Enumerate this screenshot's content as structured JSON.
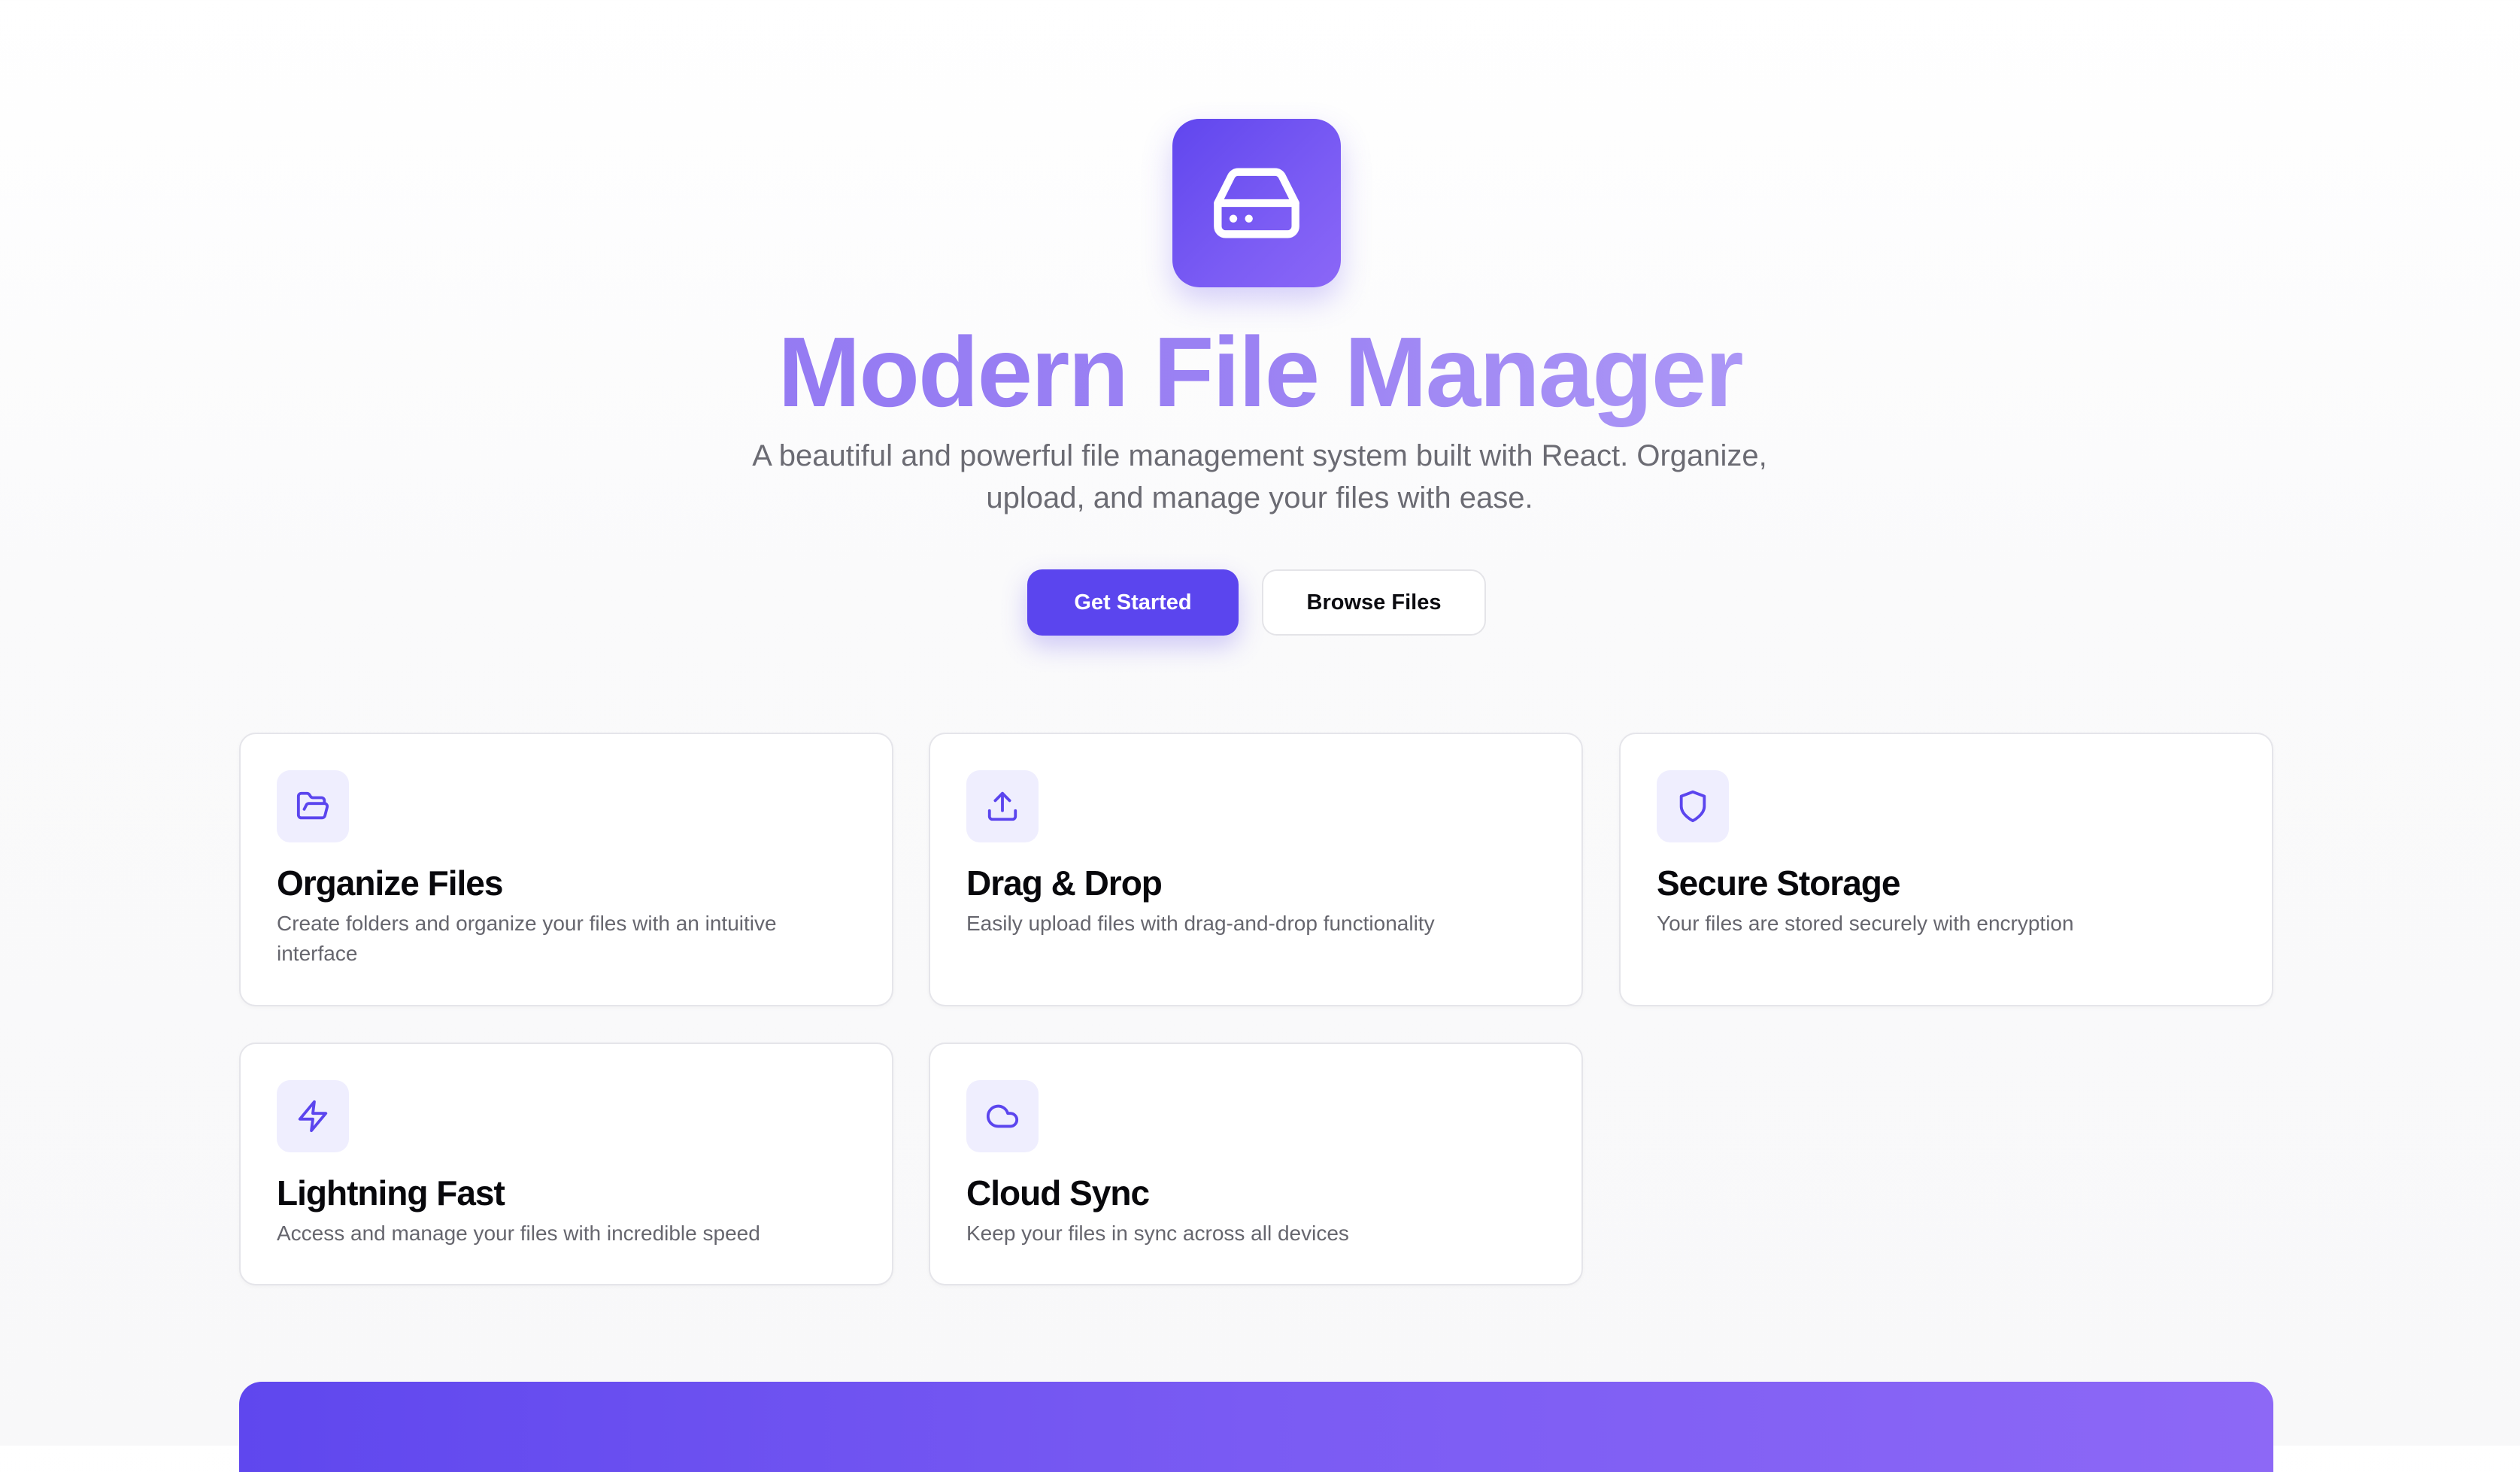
{
  "hero": {
    "icon": "hard-drive-icon",
    "title": "Modern File Manager",
    "subtitle": "A beautiful and powerful file management system built with React. Organize, upload, and manage your files with ease.",
    "primary_button": "Get Started",
    "secondary_button": "Browse Files"
  },
  "features": [
    {
      "icon": "folder-open-icon",
      "title": "Organize Files",
      "description": "Create folders and organize your files with an intuitive interface"
    },
    {
      "icon": "upload-icon",
      "title": "Drag & Drop",
      "description": "Easily upload files with drag-and-drop functionality"
    },
    {
      "icon": "shield-icon",
      "title": "Secure Storage",
      "description": "Your files are stored securely with encryption"
    },
    {
      "icon": "zap-icon",
      "title": "Lightning Fast",
      "description": "Access and manage your files with incredible speed"
    },
    {
      "icon": "cloud-icon",
      "title": "Cloud Sync",
      "description": "Keep your files in sync across all devices"
    }
  ],
  "colors": {
    "accent": "#5b45ee",
    "accent_light": "#efeefe",
    "title_gradient_start": "#8a6ff2",
    "title_gradient_end": "#c6b8fb",
    "text_muted": "#66666e",
    "card_border": "#e5e5ea"
  }
}
